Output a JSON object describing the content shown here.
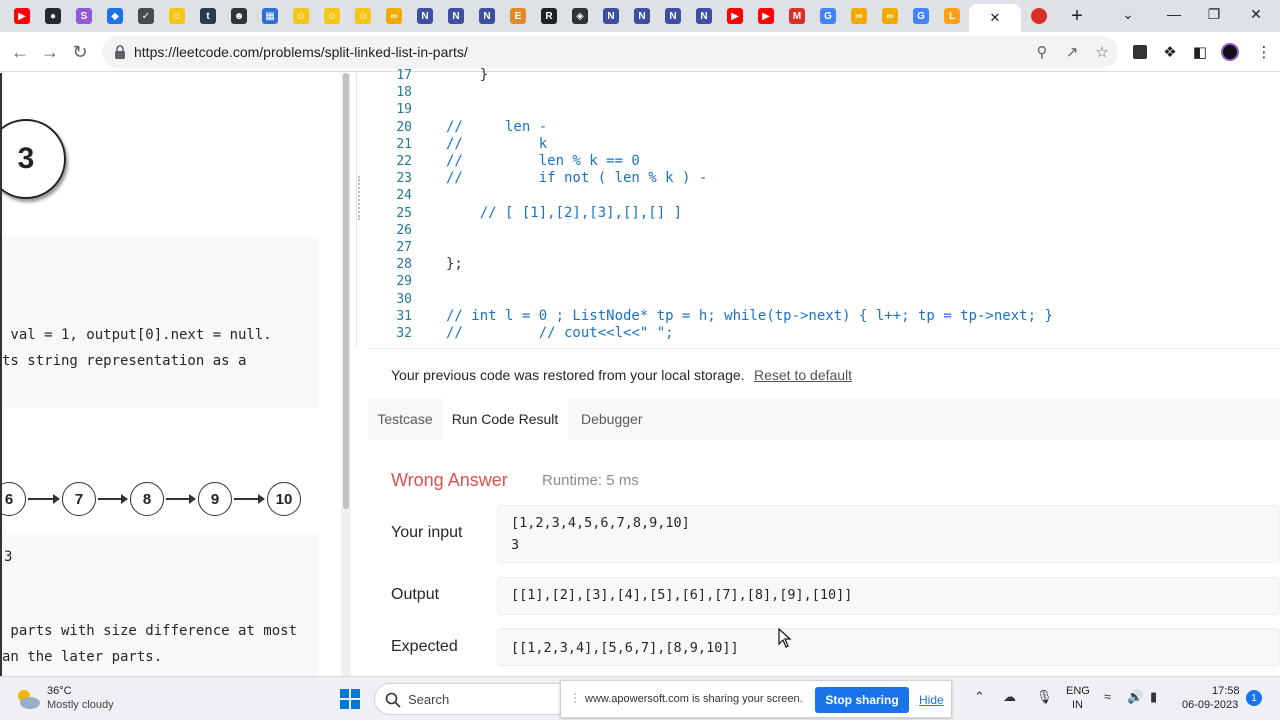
{
  "browser": {
    "url": "https://leetcode.com/problems/split-linked-list-in-parts/",
    "tabs": [
      {
        "icon": "youtube-icon",
        "color": "#ff0000"
      },
      {
        "icon": "github-icon",
        "color": "#24292f"
      },
      {
        "icon": "purple-s-icon",
        "color": "#8e5ad6"
      },
      {
        "icon": "shield-icon",
        "color": "#1a73e8"
      },
      {
        "icon": "chart-icon",
        "color": "#4a4a4a"
      },
      {
        "icon": "emoji-icon",
        "color": "#f5c518"
      },
      {
        "icon": "tds-icon",
        "color": "#2b3a4a"
      },
      {
        "icon": "robot-icon",
        "color": "#333333"
      },
      {
        "icon": "tool-icon",
        "color": "#2f6ed3"
      },
      {
        "icon": "emoji-icon",
        "color": "#f5c518"
      },
      {
        "icon": "emoji-icon",
        "color": "#f5c518"
      },
      {
        "icon": "emoji-icon",
        "color": "#f5c518"
      },
      {
        "icon": "loop-icon",
        "color": "#f2a900"
      },
      {
        "icon": "n-icon",
        "color": "#3c4fa0"
      },
      {
        "icon": "n-icon",
        "color": "#3c4fa0"
      },
      {
        "icon": "n-icon",
        "color": "#3c4fa0"
      },
      {
        "icon": "e-icon",
        "color": "#e38b2c"
      },
      {
        "icon": "r6-icon",
        "color": "#222222"
      },
      {
        "icon": "tag-icon",
        "color": "#333333"
      },
      {
        "icon": "n-icon",
        "color": "#3c4fa0"
      },
      {
        "icon": "n-icon",
        "color": "#3c4fa0"
      },
      {
        "icon": "n-icon",
        "color": "#3c4fa0"
      },
      {
        "icon": "n-icon",
        "color": "#3c4fa0"
      },
      {
        "icon": "youtube-icon",
        "color": "#ff0000"
      },
      {
        "icon": "youtube-icon",
        "color": "#ff0000"
      },
      {
        "icon": "gmail-icon",
        "color": "#d93025"
      },
      {
        "icon": "google-icon",
        "color": "#4285f4"
      },
      {
        "icon": "loop-icon",
        "color": "#f2a900"
      },
      {
        "icon": "loop-icon",
        "color": "#f2a900"
      },
      {
        "icon": "google-icon",
        "color": "#4285f4"
      },
      {
        "icon": "leetcode-icon",
        "color": "#ffa116"
      }
    ]
  },
  "problem": {
    "example_k": "3",
    "line1": " val = 1, output[0].next = null.",
    "line2": "ts string representation as a",
    "nodes": [
      "6",
      "7",
      "8",
      "9",
      "10"
    ],
    "k_fragment": "3",
    "line3": " parts with size difference at most",
    "line4": "an the later parts."
  },
  "editor": {
    "lines": [
      {
        "n": "17",
        "text": "    }",
        "kind": "plain"
      },
      {
        "n": "18",
        "text": "",
        "kind": "plain"
      },
      {
        "n": "19",
        "text": "",
        "kind": "plain"
      },
      {
        "n": "20",
        "text": "//     len -",
        "kind": "comment"
      },
      {
        "n": "21",
        "text": "//         k",
        "kind": "comment"
      },
      {
        "n": "22",
        "text": "//         len % k == 0",
        "kind": "comment"
      },
      {
        "n": "23",
        "text": "//         if not ( len % k ) -",
        "kind": "comment"
      },
      {
        "n": "24",
        "text": "",
        "kind": "plain"
      },
      {
        "n": "25",
        "text": "    // [ [1],[2],[3],[],[] ]",
        "kind": "comment"
      },
      {
        "n": "26",
        "text": "",
        "kind": "plain"
      },
      {
        "n": "27",
        "text": "",
        "kind": "plain"
      },
      {
        "n": "28",
        "text": "};",
        "kind": "plain"
      },
      {
        "n": "29",
        "text": "",
        "kind": "plain"
      },
      {
        "n": "30",
        "text": "",
        "kind": "plain"
      },
      {
        "n": "31",
        "text": "// int l = 0 ; ListNode* tp = h; while(tp->next) { l++; tp = tp->next; }",
        "kind": "comment"
      },
      {
        "n": "32",
        "text": "//         // cout<<l<<\" \";",
        "kind": "comment"
      }
    ]
  },
  "result": {
    "restore_text": "Your previous code was restored from your local storage.",
    "reset_label": "Reset to default",
    "tabs": {
      "testcase": "Testcase",
      "run_result": "Run Code Result",
      "debugger": "Debugger"
    },
    "verdict": "Wrong Answer",
    "runtime": "Runtime: 5 ms",
    "input_label": "Your input",
    "input_line1": "[1,2,3,4,5,6,7,8,9,10]",
    "input_line2": "3",
    "output_label": "Output",
    "output_value": "[[1],[2],[3],[4],[5],[6],[7],[8],[9],[10]]",
    "expected_label": "Expected",
    "expected_value": "[[1,2,3,4],[5,6,7],[8,9,10]]"
  },
  "taskbar": {
    "temperature": "36°C",
    "weather": "Mostly cloudy",
    "search_label": "Search",
    "share_text": "www.apowersoft.com is sharing your screen.",
    "stop_sharing": "Stop sharing",
    "hide": "Hide",
    "lang_top": "ENG",
    "lang_bottom": "IN",
    "time": "17:58",
    "date": "06-09-2023",
    "notifications": "1"
  },
  "colors": {
    "accent": "#1a73e8",
    "wrong": "#d9534f",
    "comment": "#1a73c8"
  }
}
